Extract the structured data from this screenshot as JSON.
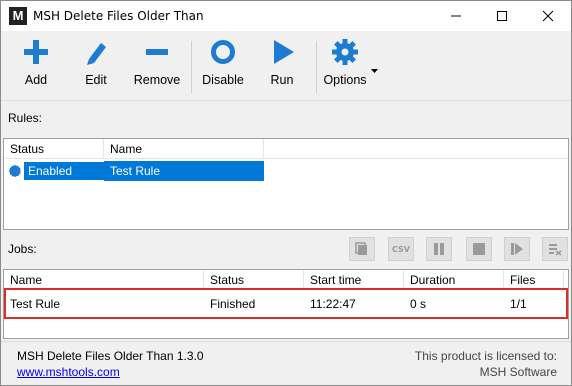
{
  "window": {
    "title": "MSH Delete Files Older Than",
    "app_icon_letter": "M"
  },
  "toolbar": {
    "buttons": [
      {
        "label": "Add",
        "icon": "plus-icon"
      },
      {
        "label": "Edit",
        "icon": "pencil-icon"
      },
      {
        "label": "Remove",
        "icon": "minus-icon"
      },
      {
        "label": "Disable",
        "icon": "disable-circle-icon"
      },
      {
        "label": "Run",
        "icon": "play-icon"
      },
      {
        "label": "Options",
        "icon": "gear-icon"
      }
    ]
  },
  "rules": {
    "label": "Rules:",
    "columns": [
      "Status",
      "Name"
    ],
    "rows": [
      {
        "status": "Enabled",
        "name": "Test Rule"
      }
    ]
  },
  "jobs": {
    "label": "Jobs:",
    "toolbar_icons": [
      "copy-icon",
      "csv-export-icon",
      "pause-icon",
      "stop-icon",
      "resume-icon",
      "clear-list-icon"
    ],
    "csv_label": "CSV",
    "columns": [
      "Name",
      "Status",
      "Start time",
      "Duration",
      "Files"
    ],
    "rows": [
      {
        "name": "Test Rule",
        "status": "Finished",
        "start_time": "11:22:47",
        "duration": "0 s",
        "files": "1/1"
      }
    ]
  },
  "footer": {
    "version": "MSH Delete Files Older Than 1.3.0",
    "link": "www.mshtools.com",
    "license_line1": "This product is licensed to:",
    "license_line2": "MSH Software"
  },
  "colors": {
    "accent": "#1e7bd2",
    "selection": "#0078d7",
    "highlight_border": "#e02b2b",
    "disabled_icon": "#9a9a9a"
  }
}
